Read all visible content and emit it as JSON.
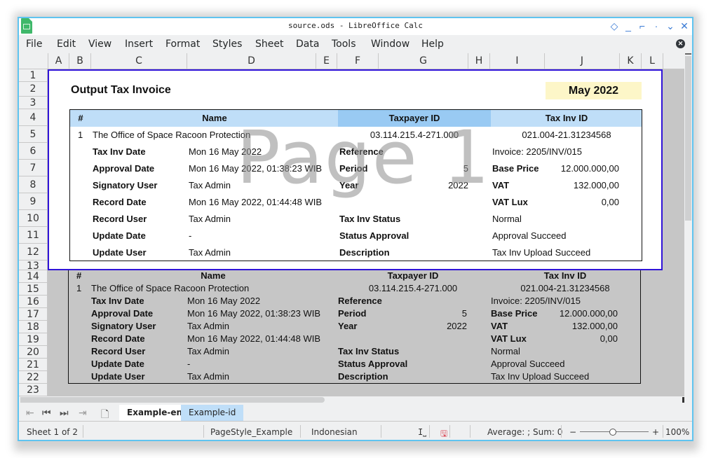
{
  "window": {
    "title": "source.ods - LibreOffice Calc",
    "controls": [
      "◇",
      "_",
      "⌐",
      "·",
      "⌄",
      "✕"
    ]
  },
  "menu": [
    "File",
    "Edit",
    "View",
    "Insert",
    "Format",
    "Styles",
    "Sheet",
    "Data",
    "Tools",
    "Window",
    "Help"
  ],
  "columns": [
    "A",
    "B",
    "C",
    "D",
    "E",
    "F",
    "G",
    "H",
    "I",
    "J",
    "K",
    "L"
  ],
  "rows": [
    "1",
    "2",
    "3",
    "4",
    "5",
    "6",
    "7",
    "8",
    "9",
    "10",
    "11",
    "12",
    "13",
    "14",
    "15",
    "16",
    "17",
    "18",
    "19",
    "20",
    "21",
    "22",
    "23"
  ],
  "invoice": {
    "title": "Output Tax Invoice",
    "month": "May 2022",
    "header": {
      "num": "#",
      "name": "Name",
      "taxpayer_id": "Taxpayer ID",
      "tax_inv_id": "Tax Inv ID"
    },
    "row": {
      "num": "1",
      "name": "The Office of Space Racoon Protection",
      "taxpayer_id": "03.114.215.4-271.000",
      "tax_inv_id": "021.004-21.31234568"
    },
    "left": [
      {
        "label": "Tax Inv Date",
        "value": "Mon 16 May 2022"
      },
      {
        "label": "Approval Date",
        "value": "Mon 16 May 2022, 01:38:23 WIB"
      },
      {
        "label": "Signatory User",
        "value": "Tax Admin"
      },
      {
        "label": "Record Date",
        "value": "Mon 16 May 2022, 01:44:48 WIB"
      },
      {
        "label": "Record User",
        "value": "Tax Admin"
      },
      {
        "label": "Update Date",
        "value": "-"
      },
      {
        "label": "Update User",
        "value": "Tax Admin"
      }
    ],
    "middle": [
      {
        "label": "Reference",
        "value": ""
      },
      {
        "label": "Period",
        "value": "5"
      },
      {
        "label": "Year",
        "value": "2022"
      },
      {
        "label": "",
        "value": ""
      },
      {
        "label": "Tax Inv Status",
        "value": ""
      },
      {
        "label": "Status Approval",
        "value": ""
      },
      {
        "label": "Description",
        "value": ""
      }
    ],
    "right": [
      {
        "label": "Invoice: 2205/INV/015",
        "value": "",
        "bold": false
      },
      {
        "label": "Base Price",
        "value": "12.000.000,00",
        "bold": true
      },
      {
        "label": "VAT",
        "value": "132.000,00",
        "bold": true
      },
      {
        "label": "VAT Lux",
        "value": "0,00",
        "bold": true
      },
      {
        "label": "Normal",
        "value": "",
        "bold": false
      },
      {
        "label": "Approval Succeed",
        "value": "",
        "bold": false
      },
      {
        "label": "Tax Inv Upload Succeed",
        "value": "",
        "bold": false
      }
    ]
  },
  "watermark": "Page 1",
  "tabs": {
    "nav": [
      "⇤",
      "⏮",
      "⏭",
      "⇥"
    ],
    "sheets": [
      {
        "label": "Example-en",
        "active": true
      },
      {
        "label": "Example-id",
        "active": false
      }
    ]
  },
  "status": {
    "sheet": "Sheet 1 of 2",
    "page_style": "PageStyle_Example",
    "language": "Indonesian",
    "selection_mode_icon": "I⎵",
    "summary": "Average: ; Sum: 0",
    "zoom_minus": "−",
    "zoom_plus": "+",
    "zoom": "100%",
    "zoom_slider_value": 0.5
  },
  "colors": {
    "page_border": "#3014d8",
    "header_blue": "#bfdef8",
    "header_blue_dark": "#99caf3",
    "month_bg": "#fdf6c8",
    "window_border": "#5fc4f0"
  }
}
